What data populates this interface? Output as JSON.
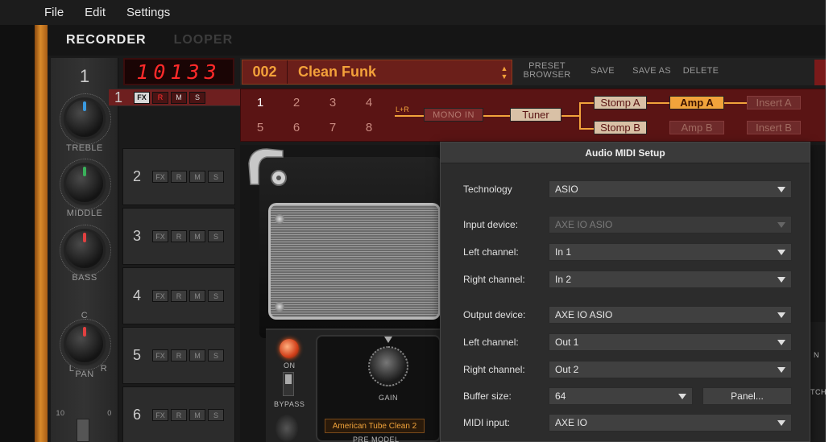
{
  "menu": [
    "File",
    "Edit",
    "Settings"
  ],
  "tabs": {
    "recorder": "RECORDER",
    "looper": "LOOPER"
  },
  "strip": {
    "channel_number": "1",
    "knobs": [
      {
        "label": "TREBLE",
        "color": "#3a9ae0"
      },
      {
        "label": "MIDDLE",
        "color": "#3ab05a"
      },
      {
        "label": "BASS",
        "color": "#e04040"
      }
    ],
    "pan": {
      "top": "C",
      "left": "L",
      "right": "R",
      "label": "PAN"
    },
    "fader_scale": {
      "top": "10",
      "side": "0"
    }
  },
  "counter": "10133",
  "tracks": [
    {
      "num": "1",
      "selected": true
    },
    {
      "num": "2",
      "selected": false
    },
    {
      "num": "3",
      "selected": false
    },
    {
      "num": "4",
      "selected": false
    },
    {
      "num": "5",
      "selected": false
    },
    {
      "num": "6",
      "selected": false
    }
  ],
  "track_buttons": {
    "fx": "FX",
    "r": "R",
    "m": "M",
    "s": "S"
  },
  "preset": {
    "number": "002",
    "name": "Clean Funk",
    "buttons": {
      "browser_l1": "PRESET",
      "browser_l2": "BROWSER",
      "save": "SAVE",
      "save_as": "SAVE AS",
      "delete": "DELETE"
    }
  },
  "chain": {
    "slots_top": [
      "1",
      "2",
      "3",
      "4"
    ],
    "slots_bottom": [
      "5",
      "6",
      "7",
      "8"
    ],
    "lr": "L+R",
    "mono_in": "MONO IN",
    "tuner": "Tuner",
    "stomp_a": "Stomp A",
    "stomp_b": "Stomp B",
    "amp_a": "Amp A",
    "amp_b": "Amp B",
    "insert_a": "Insert A",
    "insert_b": "Insert B"
  },
  "amp": {
    "on": "ON",
    "bypass": "BYPASS",
    "gain": "GAIN",
    "pre_model_value": "American Tube Clean 2",
    "pre_model": "PRE MODEL",
    "right_labels": {
      "n": "N",
      "tch": "TCH"
    }
  },
  "dialog": {
    "title": "Audio MIDI Setup",
    "technology": {
      "label": "Technology",
      "value": "ASIO"
    },
    "input_device": {
      "label": "Input device:",
      "value": "AXE IO ASIO"
    },
    "in_left": {
      "label": "Left channel:",
      "value": "In 1"
    },
    "in_right": {
      "label": "Right channel:",
      "value": "In 2"
    },
    "output_device": {
      "label": "Output device:",
      "value": "AXE IO ASIO"
    },
    "out_left": {
      "label": "Left channel:",
      "value": "Out 1"
    },
    "out_right": {
      "label": "Right channel:",
      "value": "Out 2"
    },
    "buffer": {
      "label": "Buffer size:",
      "value": "64",
      "panel_button": "Panel..."
    },
    "midi_input": {
      "label": "MIDI input:",
      "value": "AXE IO"
    }
  }
}
